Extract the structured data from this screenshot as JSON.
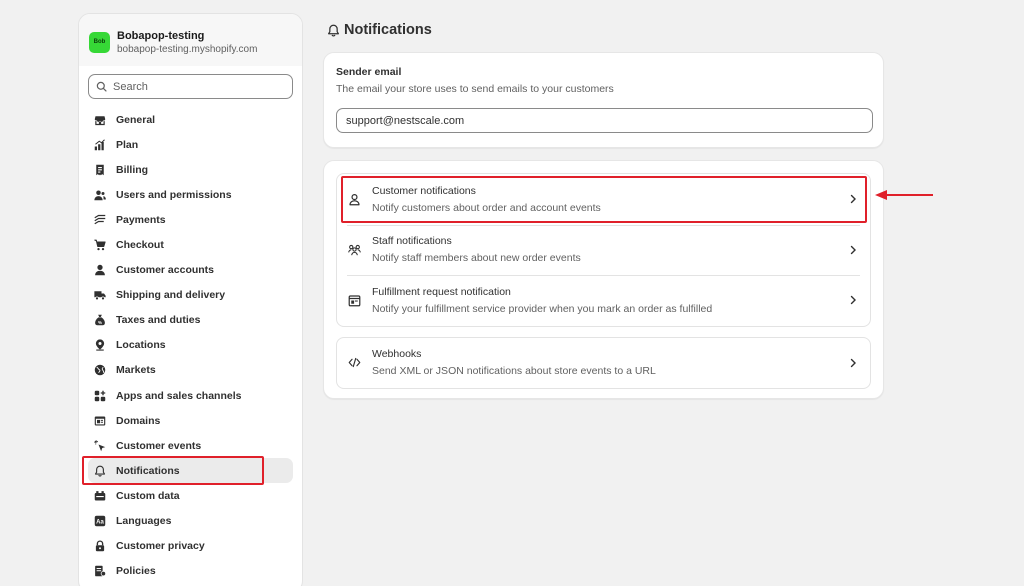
{
  "store": {
    "avatar_text": "Bob",
    "name": "Bobapop-testing",
    "domain": "bobapop-testing.myshopify.com",
    "avatar_color": "#36d836"
  },
  "search": {
    "placeholder": "Search",
    "value": ""
  },
  "sidebar": {
    "items": [
      {
        "label": "General",
        "icon": "store-icon"
      },
      {
        "label": "Plan",
        "icon": "plan-chart-icon"
      },
      {
        "label": "Billing",
        "icon": "billing-receipt-icon"
      },
      {
        "label": "Users and permissions",
        "icon": "users-icon"
      },
      {
        "label": "Payments",
        "icon": "payments-icon"
      },
      {
        "label": "Checkout",
        "icon": "cart-icon"
      },
      {
        "label": "Customer accounts",
        "icon": "person-icon"
      },
      {
        "label": "Shipping and delivery",
        "icon": "truck-icon"
      },
      {
        "label": "Taxes and duties",
        "icon": "tax-bag-icon"
      },
      {
        "label": "Locations",
        "icon": "location-pin-icon"
      },
      {
        "label": "Markets",
        "icon": "globe-icon"
      },
      {
        "label": "Apps and sales channels",
        "icon": "apps-icon"
      },
      {
        "label": "Domains",
        "icon": "domain-icon"
      },
      {
        "label": "Customer events",
        "icon": "cursor-click-icon"
      },
      {
        "label": "Notifications",
        "icon": "bell-icon",
        "active": true
      },
      {
        "label": "Custom data",
        "icon": "custom-data-icon"
      },
      {
        "label": "Languages",
        "icon": "language-icon"
      },
      {
        "label": "Customer privacy",
        "icon": "lock-icon"
      },
      {
        "label": "Policies",
        "icon": "policy-icon"
      }
    ]
  },
  "page": {
    "title": "Notifications",
    "icon": "bell-icon"
  },
  "sender_email": {
    "title": "Sender email",
    "description": "The email your store uses to send emails to your customers",
    "value": "support@nestscale.com"
  },
  "notification_rows": [
    {
      "title": "Customer notifications",
      "description": "Notify customers about order and account events",
      "icon": "person-outline-icon"
    },
    {
      "title": "Staff notifications",
      "description": "Notify staff members about new order events",
      "icon": "staff-group-icon"
    },
    {
      "title": "Fulfillment request notification",
      "description": "Notify your fulfillment service provider when you mark an order as fulfilled",
      "icon": "fulfillment-icon"
    }
  ],
  "webhooks": {
    "title": "Webhooks",
    "description": "Send XML or JSON notifications about store events to a URL",
    "icon": "code-icon"
  },
  "colors": {
    "highlight": "#e0202a",
    "background": "#f1f1f1",
    "active_nav": "#ebebeb"
  }
}
